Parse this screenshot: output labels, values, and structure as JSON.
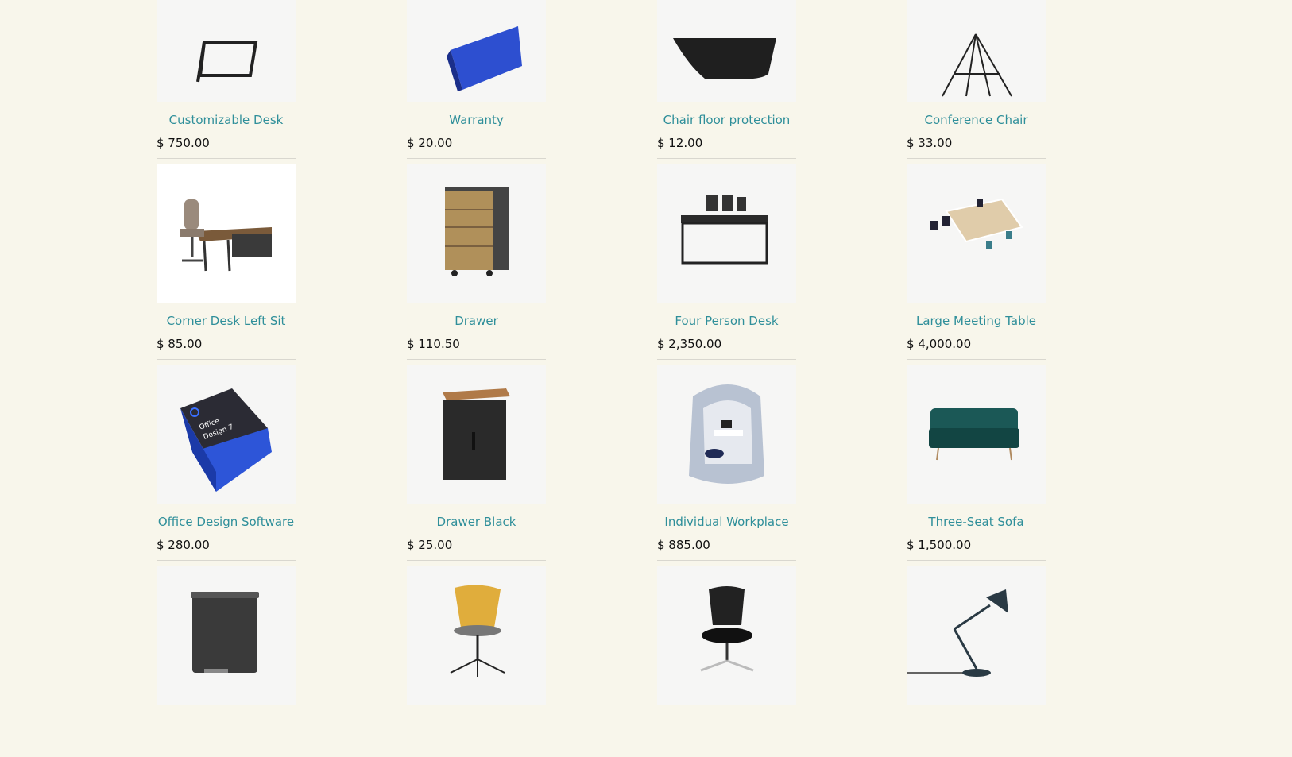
{
  "products": [
    {
      "name": "Customizable Desk",
      "price": "$ 750.00",
      "image": "desk-frame-icon"
    },
    {
      "name": "Warranty",
      "price": "$ 20.00",
      "image": "warranty-box-icon"
    },
    {
      "name": "Chair floor protection",
      "price": "$ 12.00",
      "image": "floor-mat-icon"
    },
    {
      "name": "Conference Chair",
      "price": "$ 33.00",
      "image": "stool-chair-icon"
    },
    {
      "name": "Corner Desk Left Sit",
      "price": "$ 85.00",
      "image": "corner-desk-icon"
    },
    {
      "name": "Drawer",
      "price": "$ 110.50",
      "image": "wooden-drawer-icon"
    },
    {
      "name": "Four Person Desk",
      "price": "$ 2,350.00",
      "image": "four-person-desk-icon"
    },
    {
      "name": "Large Meeting Table",
      "price": "$ 4,000.00",
      "image": "meeting-table-icon"
    },
    {
      "name": "Office Design Software",
      "price": "$ 280.00",
      "image": "software-box-icon"
    },
    {
      "name": "Drawer Black",
      "price": "$ 25.00",
      "image": "black-drawer-icon"
    },
    {
      "name": "Individual Workplace",
      "price": "$ 885.00",
      "image": "workplace-pod-icon"
    },
    {
      "name": "Three-Seat Sofa",
      "price": "$ 1,500.00",
      "image": "green-sofa-icon"
    },
    {
      "name": "",
      "price": "",
      "image": "trash-bin-icon"
    },
    {
      "name": "",
      "price": "",
      "image": "yellow-chair-icon"
    },
    {
      "name": "",
      "price": "",
      "image": "office-chair-icon"
    },
    {
      "name": "",
      "price": "",
      "image": "desk-lamp-icon"
    }
  ],
  "colors": {
    "background": "#f8f6eb",
    "link": "#2f8f9a",
    "thumb": "#f6f6f5"
  }
}
